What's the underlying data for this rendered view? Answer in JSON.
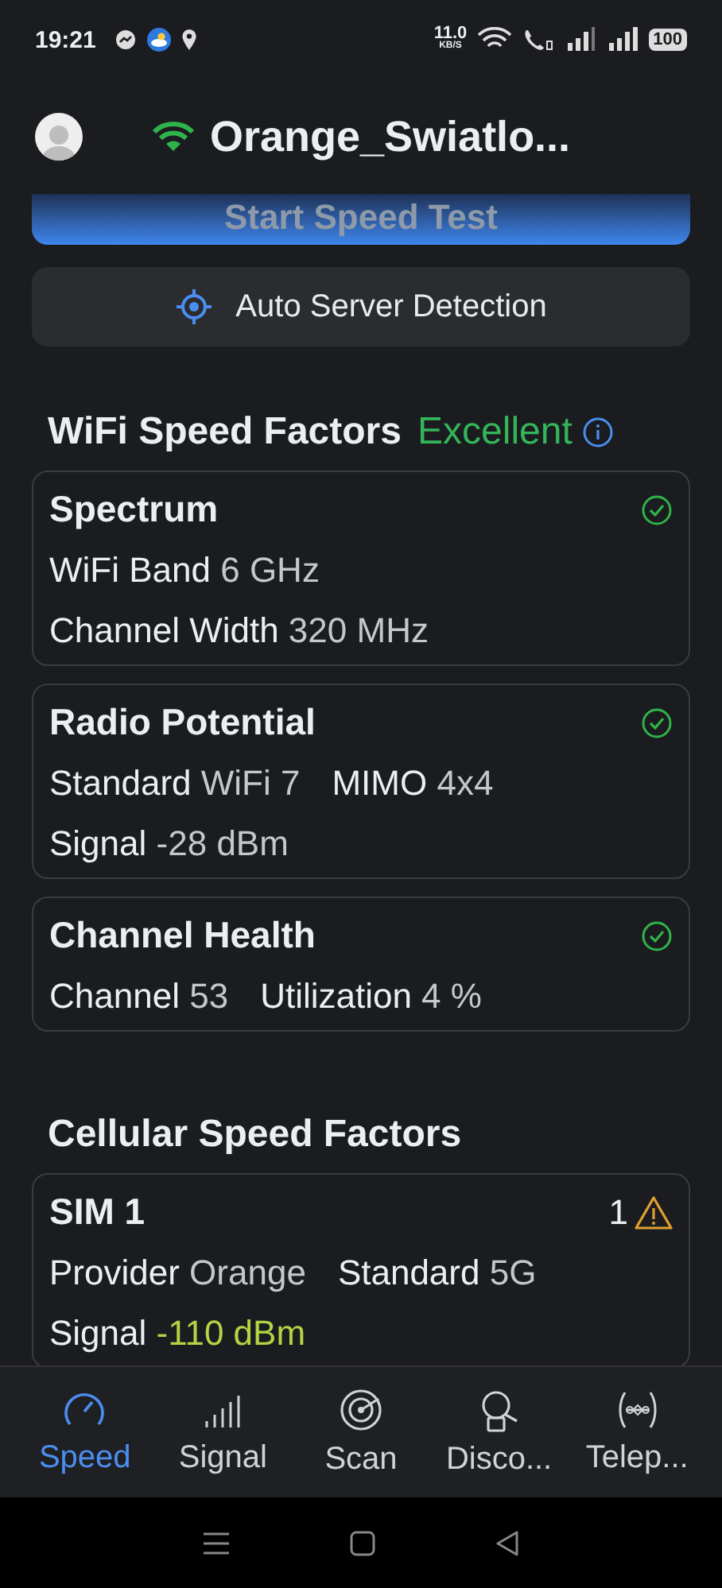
{
  "status_bar": {
    "time": "19:21",
    "speed": "11.0",
    "speed_unit": "KB/S",
    "battery": "100"
  },
  "header": {
    "network_name": "Orange_Swiatlo..."
  },
  "start_button": {
    "label": "Start Speed Test"
  },
  "server_button": {
    "label": "Auto Server Detection"
  },
  "wifi_section": {
    "title": "WiFi Speed Factors",
    "rating": "Excellent",
    "cards": [
      {
        "title": "Spectrum",
        "kind": "ok",
        "lines": [
          [
            {
              "label": "WiFi Band",
              "value": "6 GHz",
              "color": "#c4c7cb"
            }
          ],
          [
            {
              "label": "Channel Width",
              "value": "320 MHz",
              "color": "#c4c7cb"
            }
          ]
        ]
      },
      {
        "title": "Radio Potential",
        "kind": "ok",
        "lines": [
          [
            {
              "label": "Standard",
              "value": "WiFi 7",
              "color": "#c4c7cb"
            },
            {
              "label": "MIMO",
              "value": "4x4",
              "color": "#c4c7cb"
            }
          ],
          [
            {
              "label": "Signal",
              "value": "-28 dBm",
              "color": "#c4c7cb"
            }
          ]
        ]
      },
      {
        "title": "Channel Health",
        "kind": "ok",
        "lines": [
          [
            {
              "label": "Channel",
              "value": "53",
              "color": "#c4c7cb"
            },
            {
              "label": "Utilization",
              "value": "4 %",
              "color": "#c4c7cb"
            }
          ]
        ]
      }
    ]
  },
  "cellular_section": {
    "title": "Cellular Speed Factors",
    "cards": [
      {
        "title": "SIM 1",
        "kind": "warning",
        "count": "1",
        "lines": [
          [
            {
              "label": "Provider",
              "value": "Orange",
              "color": "#c4c7cb"
            },
            {
              "label": "Standard",
              "value": "5G",
              "color": "#c4c7cb"
            }
          ],
          [
            {
              "label": "Signal",
              "value": "-110 dBm",
              "color": "#b3d445"
            }
          ]
        ]
      }
    ]
  },
  "bottom_nav": [
    {
      "label": "Speed",
      "selected": true
    },
    {
      "label": "Signal",
      "selected": false
    },
    {
      "label": "Scan",
      "selected": false
    },
    {
      "label": "Disco...",
      "selected": false
    },
    {
      "label": "Telep...",
      "selected": false
    }
  ]
}
